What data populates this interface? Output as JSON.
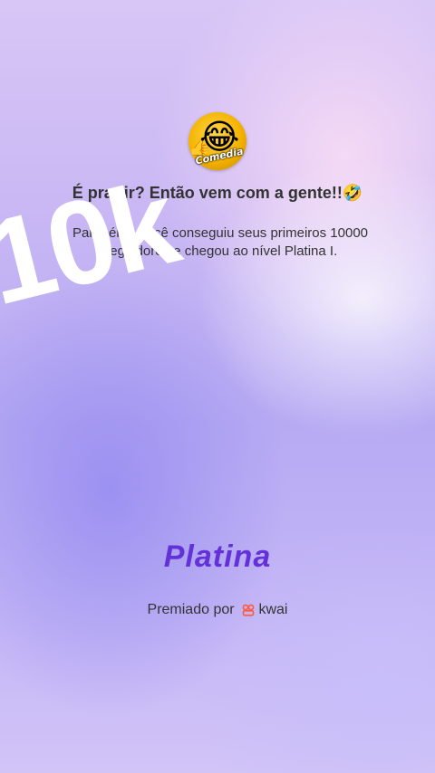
{
  "profile": {
    "avatar_caption": "Comedia",
    "avatar_emoji": "😂"
  },
  "heading": "É pra rir? Então vem com a gente!!🤣",
  "message": "Parabéns! Você conseguiu seus primeiros 10000 seguidores e chegou ao nível Platina I.",
  "overlay_text": "10k",
  "level_name": "Platina",
  "awarded_by": {
    "label": "Premiado por",
    "brand": "kwai",
    "brand_color": "#ff5a3c"
  },
  "colors": {
    "level": "#6231d8",
    "text": "#333333"
  }
}
